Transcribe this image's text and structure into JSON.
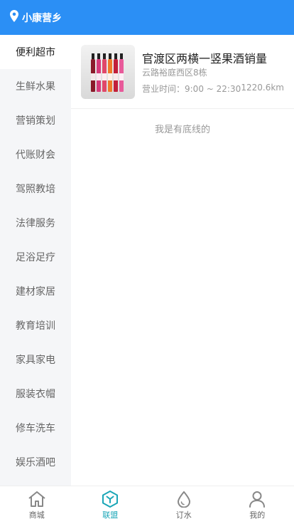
{
  "header": {
    "location": "小康营乡"
  },
  "sidebar": {
    "items": [
      {
        "label": "便利超市"
      },
      {
        "label": "生鲜水果"
      },
      {
        "label": "营销策划"
      },
      {
        "label": "代账财会"
      },
      {
        "label": "驾照教培"
      },
      {
        "label": "法律服务"
      },
      {
        "label": "足浴足疗"
      },
      {
        "label": "建材家居"
      },
      {
        "label": "教育培训"
      },
      {
        "label": "家具家电"
      },
      {
        "label": "服装衣帽"
      },
      {
        "label": "修车洗车"
      },
      {
        "label": "娱乐酒吧"
      }
    ],
    "active_index": 0
  },
  "store": {
    "name": "官渡区两横一竖果酒销量",
    "address": "云路裕庭西区8栋",
    "hours": "营业时间：9:00 ~ 22:30",
    "distance": "1220.6km"
  },
  "end_note": "我是有底线的",
  "tabs": [
    {
      "label": "商城",
      "icon": "home-icon"
    },
    {
      "label": "联盟",
      "icon": "alliance-icon"
    },
    {
      "label": "订水",
      "icon": "water-drop-icon"
    },
    {
      "label": "我的",
      "icon": "user-icon"
    }
  ],
  "active_tab": 1,
  "colors": {
    "brand": "#2b8ff5",
    "tab_active": "#1aa6b7"
  }
}
